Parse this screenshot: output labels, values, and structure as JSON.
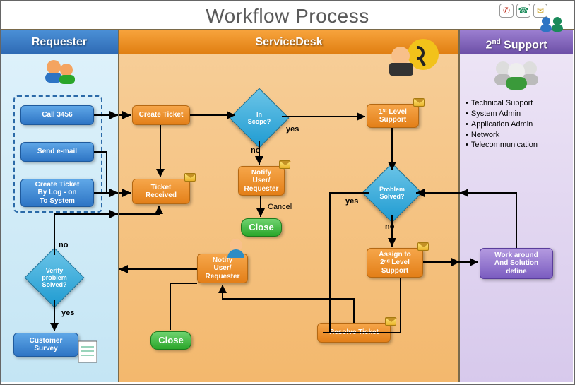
{
  "title": "Workflow Process",
  "lanes": {
    "requester": "Requester",
    "servicedesk": "ServiceDesk",
    "support_prefix": "2",
    "support_suffix": "nd",
    "support_label": "Support"
  },
  "requester": {
    "call": "Call 3456",
    "email": "Send  e-mail",
    "create_ticket": "Create Ticket\nBy Log - on\nTo System",
    "verify": "Verify problem\nSolved?",
    "survey": "Customer\nSurvey"
  },
  "servicedesk": {
    "create_ticket": "Create Ticket",
    "ticket_received": "Ticket\nReceived",
    "in_scope": "In\nScope?",
    "notify1": "Notify\nUser/\nRequester",
    "close1": "Close",
    "first_level": "1ˢᵗ Level\nSupport",
    "problem_solved": "Problem\nSolved?",
    "assign": "Assign to\n2ⁿᵈ Level\nSupport",
    "notify2": "Notify\nUser/\nRequester",
    "resolve": "Resolve Ticket",
    "close2": "Close"
  },
  "support": {
    "bullets": [
      "Technical Support",
      "System Admin",
      "Application Admin",
      "Network",
      "Telecommunication"
    ],
    "work": "Work around\nAnd Solution\ndefine"
  },
  "labels": {
    "yes": "yes",
    "no": "no",
    "cancel": "Cancel"
  }
}
